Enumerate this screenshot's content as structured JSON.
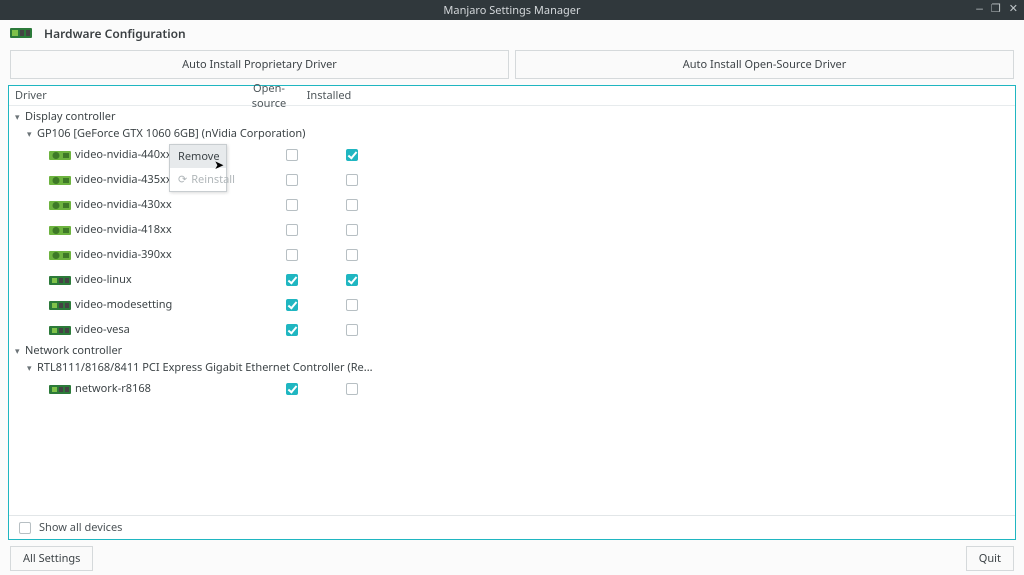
{
  "window": {
    "title": "Manjaro Settings Manager"
  },
  "header": {
    "title": "Hardware Configuration"
  },
  "buttons": {
    "auto_prop": "Auto Install Proprietary Driver",
    "auto_open": "Auto Install Open-Source Driver"
  },
  "columns": {
    "driver": "Driver",
    "open_source": "Open-source",
    "installed": "Installed"
  },
  "categories": [
    {
      "label": "Display controller",
      "devices": [
        {
          "label": "GP106 [GeForce GTX 1060 6GB] (nVidia Corporation)",
          "drivers": [
            {
              "name": "video-nvidia-440xx",
              "open_source": false,
              "installed": true,
              "icon": "gpu"
            },
            {
              "name": "video-nvidia-435xx",
              "open_source": false,
              "installed": false,
              "icon": "gpu"
            },
            {
              "name": "video-nvidia-430xx",
              "open_source": false,
              "installed": false,
              "icon": "gpu"
            },
            {
              "name": "video-nvidia-418xx",
              "open_source": false,
              "installed": false,
              "icon": "gpu"
            },
            {
              "name": "video-nvidia-390xx",
              "open_source": false,
              "installed": false,
              "icon": "gpu"
            },
            {
              "name": "video-linux",
              "open_source": true,
              "installed": true,
              "icon": "chip"
            },
            {
              "name": "video-modesetting",
              "open_source": true,
              "installed": false,
              "icon": "chip"
            },
            {
              "name": "video-vesa",
              "open_source": true,
              "installed": false,
              "icon": "chip"
            }
          ]
        }
      ]
    },
    {
      "label": "Network controller",
      "devices": [
        {
          "label": "RTL8111/8168/8411 PCI Express Gigabit Ethernet Controller (Re...",
          "drivers": [
            {
              "name": "network-r8168",
              "open_source": true,
              "installed": false,
              "icon": "chip"
            }
          ]
        }
      ]
    }
  ],
  "context_menu": {
    "remove": "Remove",
    "reinstall": "Reinstall"
  },
  "bottom": {
    "show_all": "Show all devices"
  },
  "footer": {
    "all_settings": "All Settings",
    "quit": "Quit"
  }
}
